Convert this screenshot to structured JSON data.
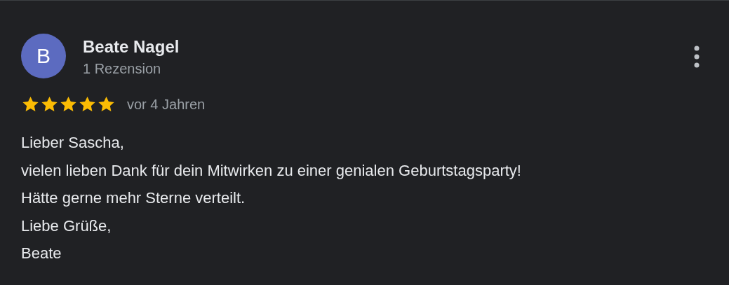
{
  "review": {
    "author": {
      "initial": "B",
      "color": "#5c6bc0",
      "name": "Beate Nagel",
      "subtitle": "1 Rezension"
    },
    "stars": 5,
    "time": "vor 4 Jahren",
    "text": "Lieber Sascha,\nvielen lieben Dank für dein Mitwirken zu einer genialen Geburtstagsparty!\nHätte gerne mehr Sterne verteilt.\nLiebe Grüße,\nBeate"
  }
}
